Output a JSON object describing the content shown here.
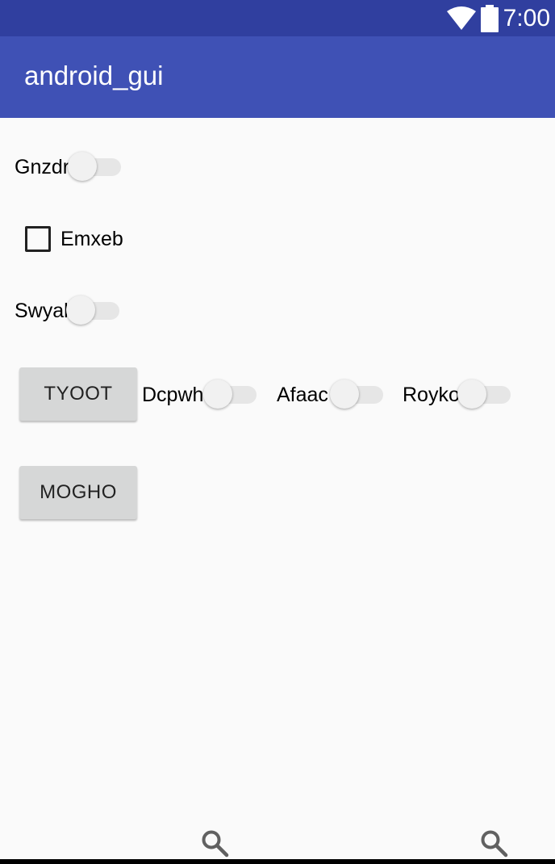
{
  "status_bar": {
    "time": "7:00",
    "icons": [
      "wifi-icon",
      "battery-icon"
    ]
  },
  "app_bar": {
    "title": "android_gui"
  },
  "controls": {
    "switch_gnzdr": {
      "label": "Gnzdr",
      "checked": false
    },
    "checkbox_emxeb": {
      "label": "Emxeb",
      "checked": false
    },
    "switch_swyal": {
      "label": "Swyal",
      "checked": false
    },
    "button_tyoot": {
      "label": "TYOOT"
    },
    "switch_dcpwh": {
      "label": "Dcpwh",
      "checked": false
    },
    "switch_afaac": {
      "label": "Afaac",
      "checked": false
    },
    "switch_royko": {
      "label": "Royko",
      "checked": false
    },
    "button_mogho": {
      "label": "MOGHO"
    }
  },
  "bottom_icons": [
    "search-icon",
    "search-icon"
  ],
  "colors": {
    "status_bar": "#303f9f",
    "app_bar": "#3f51b5",
    "background": "#fafafa",
    "button": "#d6d7d7"
  }
}
